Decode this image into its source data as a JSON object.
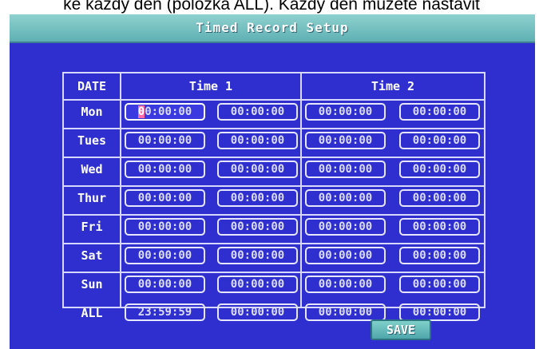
{
  "caption": "ke každý den (položka ALL). Každý den můžete nastavit",
  "title": "Timed Record Setup",
  "header": {
    "date": "DATE",
    "time1": "Time 1",
    "time2": "Time 2"
  },
  "rows": [
    {
      "day": "Mon",
      "t1_start": "00:00:00",
      "t1_end": "00:00:00",
      "t2_start": "00:00:00",
      "t2_end": "00:00:00"
    },
    {
      "day": "Tues",
      "t1_start": "00:00:00",
      "t1_end": "00:00:00",
      "t2_start": "00:00:00",
      "t2_end": "00:00:00"
    },
    {
      "day": "Wed",
      "t1_start": "00:00:00",
      "t1_end": "00:00:00",
      "t2_start": "00:00:00",
      "t2_end": "00:00:00"
    },
    {
      "day": "Thur",
      "t1_start": "00:00:00",
      "t1_end": "00:00:00",
      "t2_start": "00:00:00",
      "t2_end": "00:00:00"
    },
    {
      "day": "Fri",
      "t1_start": "00:00:00",
      "t1_end": "00:00:00",
      "t2_start": "00:00:00",
      "t2_end": "00:00:00"
    },
    {
      "day": "Sat",
      "t1_start": "00:00:00",
      "t1_end": "00:00:00",
      "t2_start": "00:00:00",
      "t2_end": "00:00:00"
    },
    {
      "day": "Sun",
      "t1_start": "00:00:00",
      "t1_end": "00:00:00",
      "t2_start": "00:00:00",
      "t2_end": "00:00:00"
    },
    {
      "day": "ALL",
      "t1_start": "23:59:59",
      "t1_end": "00:00:00",
      "t2_start": "00:00:00",
      "t2_end": "00:00:00"
    }
  ],
  "active_field": {
    "cursor_char": "0",
    "rest": "0:00:00"
  },
  "save_label": "SAVE",
  "colors": {
    "screen_bg": "#2f2fd0",
    "title_bar": "#5fb0b3",
    "grid_line": "#d8d8ff",
    "cursor": "#ff6aa8"
  }
}
